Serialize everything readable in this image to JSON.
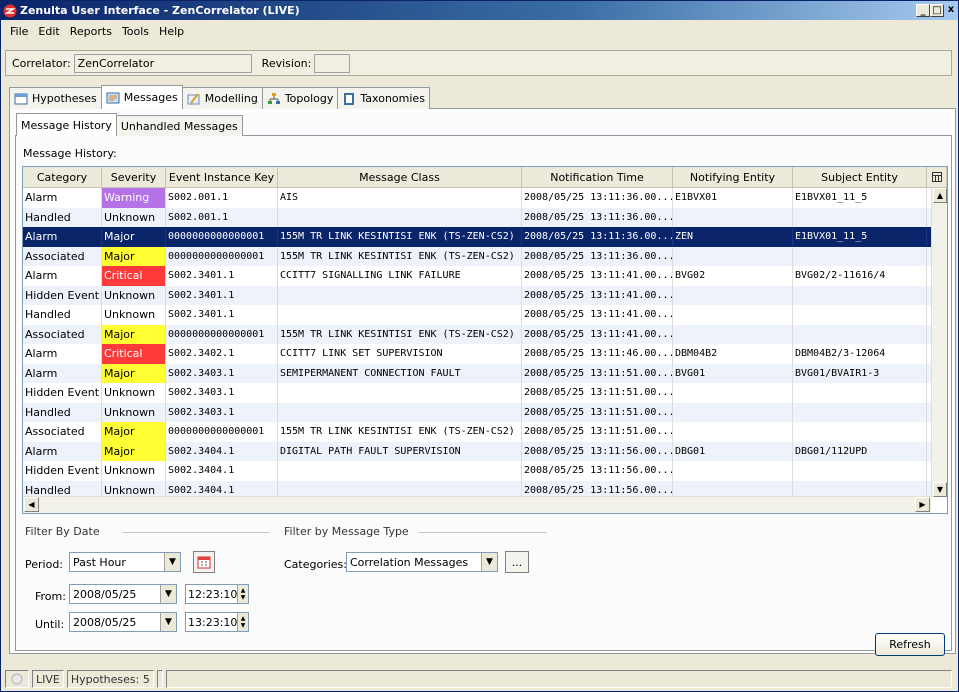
{
  "window": {
    "title": "Zenulta User Interface - ZenCorrelator (LIVE)",
    "minimize": "_",
    "maximize": "□",
    "close": "x"
  },
  "menu": [
    "File",
    "Edit",
    "Reports",
    "Tools",
    "Help"
  ],
  "correlator": {
    "label": "Correlator:",
    "value": "ZenCorrelator",
    "revision_label": "Revision:",
    "revision_value": ""
  },
  "tabs": [
    {
      "label": "Hypotheses",
      "icon": "hypotheses-icon"
    },
    {
      "label": "Messages",
      "icon": "messages-icon"
    },
    {
      "label": "Modelling",
      "icon": "modelling-icon"
    },
    {
      "label": "Topology",
      "icon": "topology-icon"
    },
    {
      "label": "Taxonomies",
      "icon": "taxonomies-icon"
    }
  ],
  "subtabs": [
    "Message History",
    "Unhandled Messages"
  ],
  "message_history_label": "Message History:",
  "table": {
    "columns": [
      "Category",
      "Severity",
      "Event Instance Key",
      "Message Class",
      "Notification Time",
      "Notifying Entity",
      "Subject Entity"
    ],
    "rows": [
      {
        "category": "Alarm",
        "severity": "Warning",
        "key": "S002.001.1",
        "cls": "AIS",
        "time": "2008/05/25 13:11:36.00...",
        "ent": "E1BVX01",
        "sub": "E1BVX01_11_5"
      },
      {
        "category": "Handled",
        "severity": "Unknown",
        "key": "S002.001.1",
        "cls": "",
        "time": "2008/05/25 13:11:36.00...",
        "ent": "",
        "sub": ""
      },
      {
        "category": "Alarm",
        "severity": "Major",
        "key": "0000000000000001",
        "cls": "155M TR LINK KESINTISI ENK (TS-ZEN-CS2)",
        "time": "2008/05/25 13:11:36.00...",
        "ent": "ZEN",
        "sub": "E1BVX01_11_5"
      },
      {
        "category": "Associated",
        "severity": "Major",
        "key": "0000000000000001",
        "cls": "155M TR LINK KESINTISI ENK (TS-ZEN-CS2)",
        "time": "2008/05/25 13:11:36.00...",
        "ent": "",
        "sub": ""
      },
      {
        "category": "Alarm",
        "severity": "Critical",
        "key": "S002.3401.1",
        "cls": "CCITT7 SIGNALLING LINK FAILURE",
        "time": "2008/05/25 13:11:41.00...",
        "ent": "BVG02",
        "sub": "BVG02/2-11616/4"
      },
      {
        "category": "Hidden Event",
        "severity": "Unknown",
        "key": "S002.3401.1",
        "cls": "",
        "time": "2008/05/25 13:11:41.00...",
        "ent": "",
        "sub": ""
      },
      {
        "category": "Handled",
        "severity": "Unknown",
        "key": "S002.3401.1",
        "cls": "",
        "time": "2008/05/25 13:11:41.00...",
        "ent": "",
        "sub": ""
      },
      {
        "category": "Associated",
        "severity": "Major",
        "key": "0000000000000001",
        "cls": "155M TR LINK KESINTISI ENK (TS-ZEN-CS2)",
        "time": "2008/05/25 13:11:41.00...",
        "ent": "",
        "sub": ""
      },
      {
        "category": "Alarm",
        "severity": "Critical",
        "key": "S002.3402.1",
        "cls": "CCITT7 LINK SET SUPERVISION",
        "time": "2008/05/25 13:11:46.00...",
        "ent": "DBM04B2",
        "sub": "DBM04B2/3-12064"
      },
      {
        "category": "Alarm",
        "severity": "Major",
        "key": "S002.3403.1",
        "cls": "SEMIPERMANENT CONNECTION FAULT",
        "time": "2008/05/25 13:11:51.00...",
        "ent": "BVG01",
        "sub": "BVG01/BVAIR1-3"
      },
      {
        "category": "Hidden Event",
        "severity": "Unknown",
        "key": "S002.3403.1",
        "cls": "",
        "time": "2008/05/25 13:11:51.00...",
        "ent": "",
        "sub": ""
      },
      {
        "category": "Handled",
        "severity": "Unknown",
        "key": "S002.3403.1",
        "cls": "",
        "time": "2008/05/25 13:11:51.00...",
        "ent": "",
        "sub": ""
      },
      {
        "category": "Associated",
        "severity": "Major",
        "key": "0000000000000001",
        "cls": "155M TR LINK KESINTISI ENK (TS-ZEN-CS2)",
        "time": "2008/05/25 13:11:51.00...",
        "ent": "",
        "sub": ""
      },
      {
        "category": "Alarm",
        "severity": "Major",
        "key": "S002.3404.1",
        "cls": "DIGITAL PATH FAULT SUPERVISION",
        "time": "2008/05/25 13:11:56.00...",
        "ent": "DBG01",
        "sub": "DBG01/112UPD"
      },
      {
        "category": "Hidden Event",
        "severity": "Unknown",
        "key": "S002.3404.1",
        "cls": "",
        "time": "2008/05/25 13:11:56.00...",
        "ent": "",
        "sub": ""
      },
      {
        "category": "Handled",
        "severity": "Unknown",
        "key": "S002.3404.1",
        "cls": "",
        "time": "2008/05/25 13:11:56.00...",
        "ent": "",
        "sub": ""
      }
    ],
    "selected_row": 2
  },
  "severity_colors": {
    "Warning": "#b571e6",
    "Major": "#ffff33",
    "Critical": "#ff3a3a"
  },
  "filter_date": {
    "title": "Filter By Date",
    "period_label": "Period:",
    "period_value": "Past Hour",
    "from_label": "From:",
    "from_date": "2008/05/25",
    "from_time": "12:23:10",
    "until_label": "Until:",
    "until_date": "2008/05/25",
    "until_time": "13:23:10"
  },
  "filter_type": {
    "title": "Filter by Message Type",
    "categories_label": "Categories:",
    "categories_value": "Correlation Messages",
    "browse_label": "..."
  },
  "refresh_label": "Refresh",
  "status": {
    "live": "LIVE",
    "hypotheses": "Hypotheses: 5"
  }
}
